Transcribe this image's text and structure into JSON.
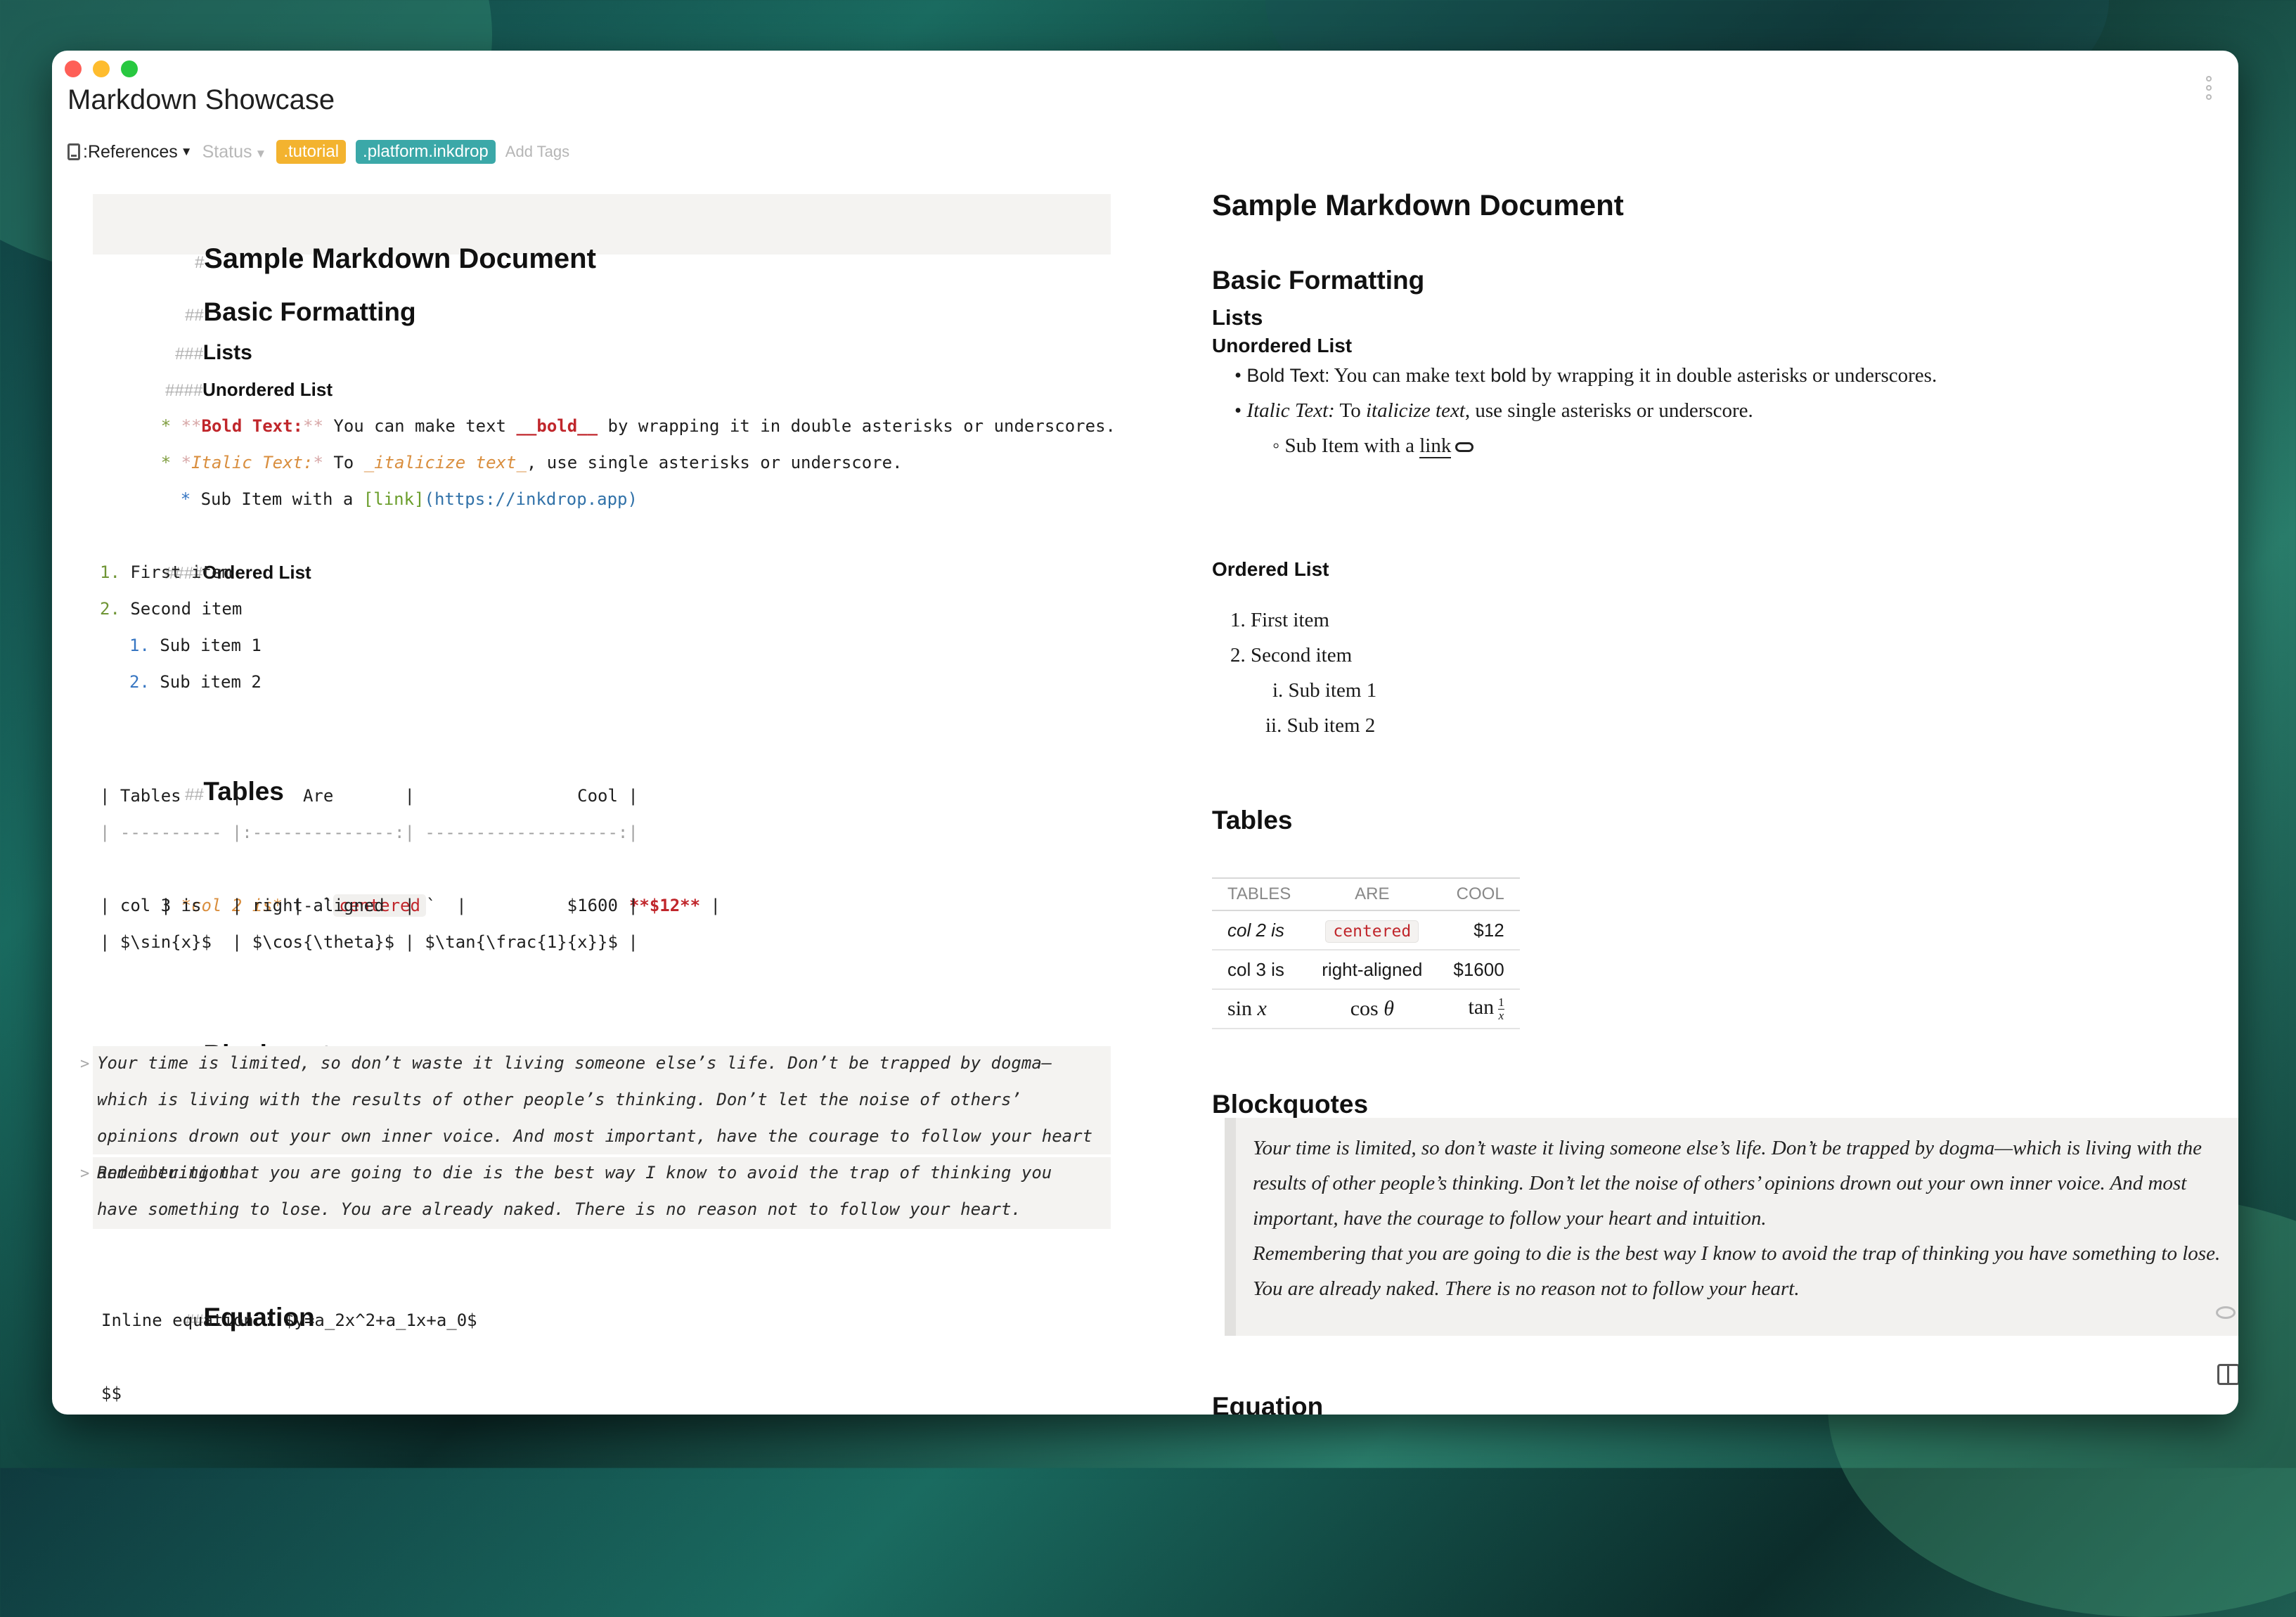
{
  "window": {
    "title": "Markdown Showcase"
  },
  "meta": {
    "notebook": ":References",
    "status": "Status",
    "tags": [
      ".tutorial",
      ".platform.inkdrop"
    ],
    "add_tags": "Add Tags"
  },
  "editor": {
    "h1_mark": "#",
    "h1": "Sample Markdown Document",
    "h2_mark": "##",
    "h2_basic": "Basic Formatting",
    "h3_mark": "###",
    "h3_lists": "Lists",
    "h4_mark": "####",
    "h4_unordered": "Unordered List",
    "bullet1": {
      "marker": "*",
      "open": "**",
      "label": "Bold Text:",
      "close": "**",
      "t1": " You can make text ",
      "bold_md": "__bold__",
      "t2": " by wrapping it in double asterisks or underscores."
    },
    "bullet2": {
      "marker": "*",
      "open": "*",
      "label": "Italic Text:",
      "close": "*",
      "t1": " To ",
      "ital_md": "_italicize text_",
      "t2": ", use single asterisks or underscore."
    },
    "bullet3": {
      "marker": "*",
      "t1": " Sub Item with a ",
      "link": "[link]",
      "url": "(https://inkdrop.app)"
    },
    "h4_ordered": "Ordered List",
    "ol": [
      {
        "n": "1.",
        "t": "First item"
      },
      {
        "n": "2.",
        "t": "Second item"
      },
      {
        "n": "1.",
        "t": "Sub item 1"
      },
      {
        "n": "2.",
        "t": "Sub item 2"
      }
    ],
    "h2_tables": "Tables",
    "table_lines": {
      "l1": "| Tables     |      Are       |                Cool |",
      "l2": "| ---------- |:--------------:| -------------------:|",
      "l3a": "| ",
      "l3b": "*col 2 is*",
      "l3c": " |  `",
      "l3d": "centered",
      "l3e": "`  |                ",
      "l3f": "**$12**",
      "l3g": " |",
      "l4": "| col 3 is   | right-aligned  |               $1600 |",
      "l5": "| $\\sin{x}$  | $\\cos{\\theta}$ | $\\tan{\\frac{1}{x}}$ |"
    },
    "h2_blockquotes": "Blockquotes",
    "quote1": "Your time is limited, so don’t waste it living someone else’s life. Don’t be trapped by dogma—which is living with the results of other people’s thinking. Don’t let the noise of others’ opinions drown out your own inner voice. And most important, have the courage to follow your heart and intuition.",
    "quote2": "Remembering that you are going to die is the best way I know to avoid the trap of thinking you have something to lose. You are already naked. There is no reason not to follow your heart.",
    "quote_mark": ">",
    "h2_equation": "Equation",
    "inline_eq": "Inline equation : $y=a_2x^2+a_1x+a_0$",
    "block_eq": "$$"
  },
  "preview": {
    "h1": "Sample Markdown Document",
    "h2_basic": "Basic Formatting",
    "h3_lists": "Lists",
    "h4_unordered": "Unordered List",
    "b1_label": "Bold Text:",
    "b1_t1": " You can make text ",
    "b1_bold": "bold",
    "b1_t2": " by wrapping it in double asterisks or underscores.",
    "b2_label": "Italic Text:",
    "b2_t1": " To ",
    "b2_ital": "italicize text",
    "b2_t2": ", use single asterisks or underscore.",
    "b3_t1": "Sub Item with a ",
    "b3_link": "link",
    "h4_ordered": "Ordered List",
    "ol": [
      "1. First item",
      "2. Second item",
      "i. Sub item 1",
      "ii. Sub item 2"
    ],
    "h2_tables": "Tables",
    "table": {
      "headers": [
        "TABLES",
        "ARE",
        "COOL"
      ],
      "r1": [
        "col 2 is",
        "centered",
        "$12"
      ],
      "r2": [
        "col 3 is",
        "right-aligned",
        "$1600"
      ],
      "r3a": "sin",
      "r3a_var": "x",
      "r3b": "cos",
      "r3b_var": "θ",
      "r3c": "tan",
      "r3c_num": "1",
      "r3c_den": "x"
    },
    "h2_blockquotes": "Blockquotes",
    "quote1": "Your time is limited, so don’t waste it living someone else’s life. Don’t be trapped by dogma—which is living with the results of other people’s thinking. Don’t let the noise of others’ opinions drown out your own inner voice. And most important, have the courage to follow your heart and intuition.",
    "quote2": "Remembering that you are going to die is the best way I know to avoid the trap of thinking you have something to lose. You are already naked. There is no reason not to follow your heart.",
    "h2_equation": "Equation"
  },
  "colors": {
    "accent_red": "#c0262b",
    "tag_yellow": "#f3b32f",
    "tag_teal": "#3ba8a8"
  }
}
